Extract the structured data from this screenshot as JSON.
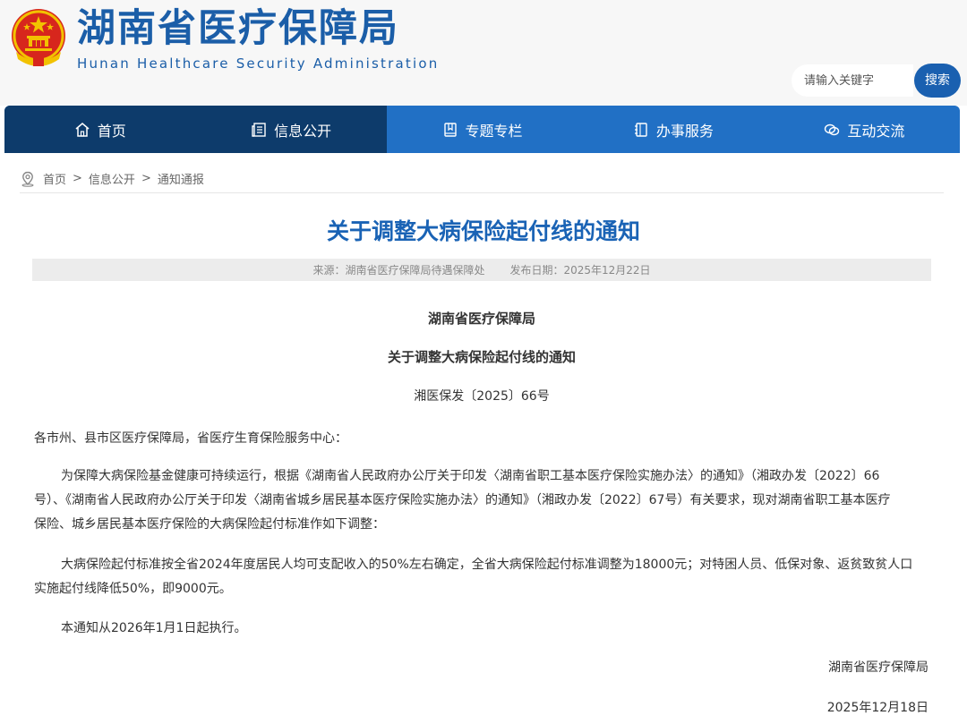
{
  "header": {
    "site_title": "湖南省医疗保障局",
    "site_subtitle": "Hunan Healthcare Security Administration",
    "search": {
      "placeholder": "请输入关键字",
      "button_label": "搜索"
    }
  },
  "nav": [
    {
      "label": "首页",
      "icon": "home-icon"
    },
    {
      "label": "信息公开",
      "icon": "news-icon"
    },
    {
      "label": "专题专栏",
      "icon": "book-icon"
    },
    {
      "label": "办事服务",
      "icon": "notebook-icon"
    },
    {
      "label": "互动交流",
      "icon": "chat-icon"
    }
  ],
  "breadcrumb": [
    "首页",
    "信息公开",
    "通知通报"
  ],
  "article": {
    "title": "关于调整大病保险起付线的通知",
    "source": "来源：湖南省医疗保障局待遇保障处",
    "publish_date": "发布日期：2025年12月22日",
    "org": "湖南省医疗保障局",
    "doc_title": "关于调整大病保险起付线的通知",
    "doc_number": "湘医保发〔2025〕66号",
    "salutation": "各市州、县市区医疗保障局，省医疗生育保险服务中心：",
    "para1_line1": "为保障大病保险基金健康可持续运行，根据《湖南省人民政府办公厅关于印发〈湖南省职工基本医疗保险实施办法〉的通知》（湘政办发〔2022〕66",
    "para1_line2": "号）、《湖南省人民政府办公厅关于印发〈湖南省城乡居民基本医疗保险实施办法〉的通知》（湘政办发〔2022〕67号）有关要求，现对湖南省职工基本医疗",
    "para1_line3": "保险、城乡居民基本医疗保险的大病保险起付标准作如下调整：",
    "para2_line1": "大病保险起付标准按全省2024年度居民人均可支配收入的50%左右确定，全省大病保险起付标准调整为18000元；对特困人员、低保对象、返贫致贫人口",
    "para2_line2": "实施起付线降低50%，即9000元。",
    "para3": "本通知从2026年1月1日起执行。",
    "signature": "湖南省医疗保障局",
    "sign_date": "2025年12月18日"
  }
}
